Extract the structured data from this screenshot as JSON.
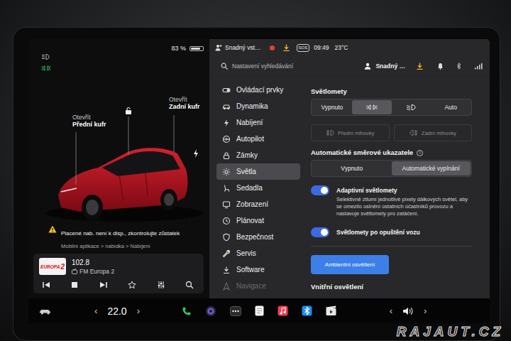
{
  "left_panel": {
    "battery": {
      "text": "83 %",
      "level": 0.83
    },
    "front_trunk": {
      "action": "Otevřít",
      "label": "Přední kufr"
    },
    "rear_trunk": {
      "action": "Otevřít",
      "label": "Zadní kufr"
    },
    "alert": {
      "title": "Placené nab. není k disp., zkontrolujte zůstatek",
      "subtitle": "Mobilní aplikace > nabídka > Nabíjení"
    },
    "media": {
      "logo": "EUROPA",
      "logo_number": "2",
      "frequency": "102.8",
      "station": "FM Europa 2"
    }
  },
  "status_bar": {
    "profile": "Snadný vst…",
    "sos": "SOS",
    "time": "09:49",
    "temperature": "23°C"
  },
  "search": {
    "placeholder": "Nastavení vyhledávání",
    "profile": "Snadný …"
  },
  "menu": [
    {
      "label": "Ovládací prvky",
      "selected": false,
      "faded": false
    },
    {
      "label": "Dynamika",
      "selected": false,
      "faded": false
    },
    {
      "label": "Nabíjení",
      "selected": false,
      "faded": false
    },
    {
      "label": "Autopilot",
      "selected": false,
      "faded": false
    },
    {
      "label": "Zámky",
      "selected": false,
      "faded": false
    },
    {
      "label": "Světla",
      "selected": true,
      "faded": false
    },
    {
      "label": "Sedadla",
      "selected": false,
      "faded": false
    },
    {
      "label": "Zobrazení",
      "selected": false,
      "faded": false
    },
    {
      "label": "Plánovat",
      "selected": false,
      "faded": false
    },
    {
      "label": "Bezpečnost",
      "selected": false,
      "faded": false
    },
    {
      "label": "Servis",
      "selected": false,
      "faded": false
    },
    {
      "label": "Software",
      "selected": false,
      "faded": false
    },
    {
      "label": "Navigace",
      "selected": false,
      "faded": true
    }
  ],
  "settings": {
    "headlights": {
      "title": "Světlomety",
      "options": [
        {
          "kind": "text",
          "label": "Vypnuto",
          "selected": false
        },
        {
          "kind": "parking",
          "selected": true
        },
        {
          "kind": "lowbeam",
          "selected": false
        },
        {
          "kind": "text",
          "label": "Auto",
          "selected": false
        }
      ]
    },
    "fog_lights": [
      {
        "label": "Přední mlhovky",
        "disabled": true
      },
      {
        "label": "Zadní mlhovky",
        "disabled": true
      }
    ],
    "turn_signals": {
      "title": "Automatické směrové ukazatele",
      "info": "i",
      "options": [
        {
          "label": "Vypnuto",
          "selected": false
        },
        {
          "label": "Automatické vypínání",
          "selected": true
        }
      ]
    },
    "toggles": [
      {
        "label": "Adaptivní světlomety",
        "on": true,
        "description": "Selektivně ztlumí jednotlivé pixely dálkových světel, aby se omezilo oslnění ostatních účastníků provozu a nastavuje světlomety pro zatáčení."
      },
      {
        "label": "Světlomety po opuštění vozu",
        "on": true
      }
    ],
    "ambient_button": "Ambientní osvětlení",
    "next_section": "Vnitřní osvětlení"
  },
  "bottom_bar": {
    "temp_down": "‹",
    "temperature": "22.0",
    "temp_up": "›",
    "volume_down": "‹",
    "volume_up": "›"
  },
  "watermark": "RAJAUT.CZ"
}
